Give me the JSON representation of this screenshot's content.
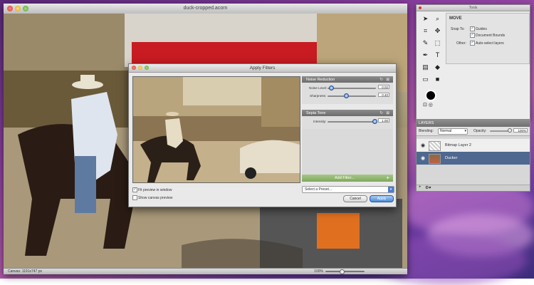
{
  "desktop": {
    "colors": {
      "bg": "#7a3b9e"
    }
  },
  "main_window": {
    "title": "duck-cropped.acorn",
    "status_left": "Canvas: 1191x747 px",
    "zoom_label": "100%"
  },
  "dialog": {
    "title": "Apply Filters",
    "filters": [
      {
        "name": "Noise Reduction",
        "params": [
          {
            "label": "Noise Level:",
            "value": "0.02",
            "fraction": 0.05
          },
          {
            "label": "Sharpness:",
            "value": "0.40",
            "fraction": 0.4
          }
        ]
      },
      {
        "name": "Sepia Tone",
        "params": [
          {
            "label": "Intensity:",
            "value": "1.00",
            "fraction": 1.0
          }
        ]
      }
    ],
    "add_filter_label": "Add Filter...",
    "preset_placeholder": "Select a Preset...",
    "fit_preview_label": "Fit preview in window",
    "fit_preview_checked": true,
    "show_canvas_label": "Show canvas preview",
    "show_canvas_checked": false,
    "cancel_label": "Cancel",
    "apply_label": "Apply"
  },
  "tools_palette": {
    "title": "Tools",
    "tool_icons": [
      "arrow-select-icon",
      "zoom-icon",
      "crop-icon",
      "move-icon",
      "brush-icon",
      "marquee-icon",
      "pen-icon",
      "text-icon",
      "gradient-icon",
      "fill-bucket-icon",
      "eraser-icon",
      "shape-icon",
      "color-well-icon"
    ],
    "tool_options": {
      "heading": "MOVE",
      "snap_to_label": "Snap To:",
      "guides_label": "Guides",
      "document_bounds_label": "Document Bounds",
      "other_label": "Other:",
      "auto_select_label": "Auto-select layers"
    }
  },
  "layers_panel": {
    "header": "LAYERS",
    "blending_label": "Blending:",
    "blending_value": "Normal",
    "opacity_label": "Opacity:",
    "opacity_value": "100%",
    "layers": [
      {
        "name": "Bitmap Layer 2",
        "selected": false
      },
      {
        "name": "Ducker",
        "selected": true
      }
    ]
  }
}
